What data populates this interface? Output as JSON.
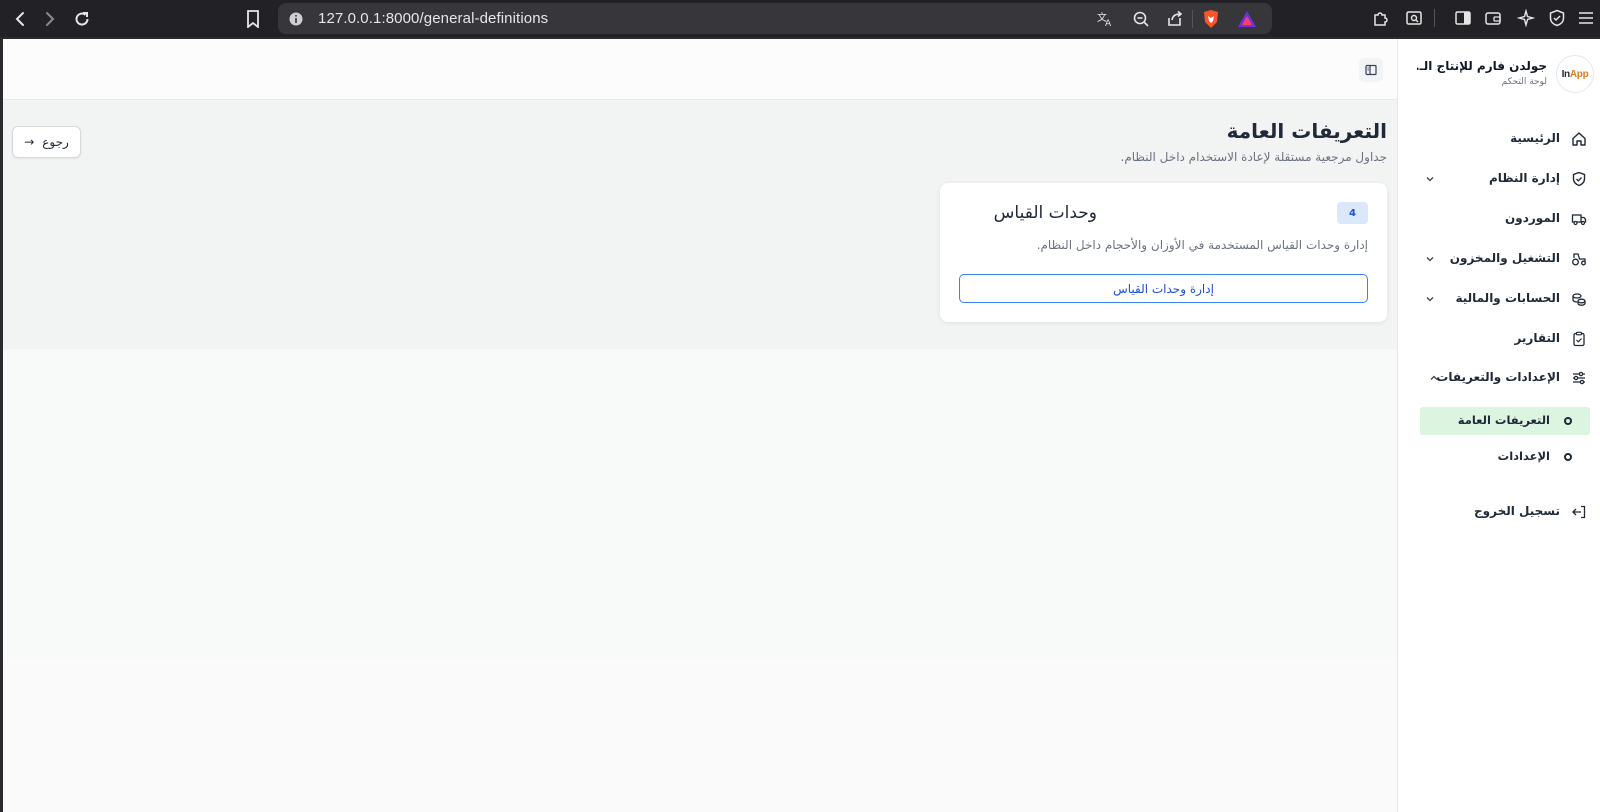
{
  "browser": {
    "url": "127.0.0.1:8000/general-definitions",
    "icons": [
      "back-icon",
      "forward-icon",
      "reload-icon",
      "bookmark-icon",
      "site-info-icon",
      "translate-icon",
      "zoom-icon",
      "share-icon",
      "brave-shields-icon",
      "brave-rewards-icon",
      "extensions-icon",
      "reader-icon",
      "sidebar-icon",
      "wallet-icon",
      "leo-ai-icon",
      "vpn-icon",
      "menu-icon"
    ]
  },
  "sidebar": {
    "logo": {
      "part1": "In",
      "part2": "App"
    },
    "brand_name": "جولدن فارم للإنتاج الـ...",
    "brand_sub": "لوحة التحكم",
    "items": [
      {
        "label": "الرئيسية",
        "icon": "home-icon"
      },
      {
        "label": "إدارة النظام",
        "icon": "shield-icon"
      },
      {
        "label": "الموردون",
        "icon": "truck-icon"
      },
      {
        "label": "التشغيل والمخزون",
        "icon": "tractor-icon"
      },
      {
        "label": "الحسابات والمالية",
        "icon": "coins-icon"
      },
      {
        "label": "التقارير",
        "icon": "clipboard-icon"
      },
      {
        "label": "الإعدادات والتعريفات",
        "icon": "sliders-icon"
      }
    ],
    "sub_items": [
      {
        "label": "التعريفات العامة",
        "active": true
      },
      {
        "label": "الإعدادات",
        "active": false
      }
    ],
    "logout": "تسجيل الخروج"
  },
  "main": {
    "title": "التعريفات العامة",
    "subtitle": "جداول مرجعية مستقلة لإعادة الاستخدام داخل النظام.",
    "back_label": "رجوع",
    "back_arrow": "→",
    "card": {
      "title": "وحدات القياس",
      "count": "4",
      "description": "إدارة وحدات القياس المستخدمة في الأوزان والأحجام داخل النظام.",
      "button_label": "إدارة وحدات القياس"
    }
  },
  "colors": {
    "accent": "#3b82f6",
    "active_bg": "#dcf5e1",
    "badge_bg": "#dbe8fb"
  }
}
